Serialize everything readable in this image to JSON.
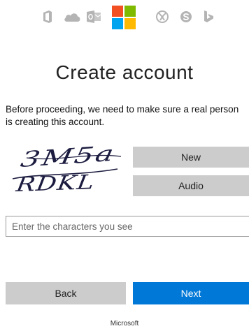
{
  "header": {
    "icons": [
      "office-icon",
      "onedrive-icon",
      "outlook-icon",
      "microsoft-logo",
      "xbox-icon",
      "skype-icon",
      "bing-icon"
    ],
    "icon_color": "#b4b4b4",
    "logo_colors": [
      "#f25022",
      "#7fba00",
      "#00a4ef",
      "#ffb900"
    ]
  },
  "main": {
    "title": "Create account",
    "description": "Before proceeding, we need to make sure a real person is creating this account.",
    "captcha": {
      "text_line1": "3M5a",
      "text_line2": "RDKL"
    },
    "new_label": "New",
    "audio_label": "Audio",
    "input_placeholder": "Enter the characters you see",
    "input_value": ""
  },
  "actions": {
    "back_label": "Back",
    "next_label": "Next",
    "accent": "#0078d7"
  },
  "footer": {
    "brand": "Microsoft"
  }
}
